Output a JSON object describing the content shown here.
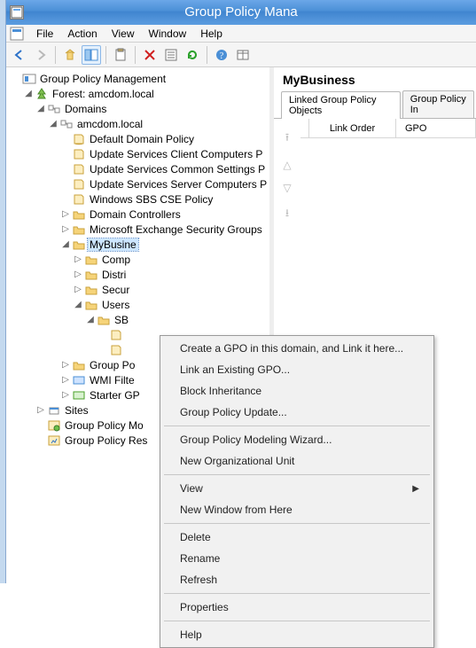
{
  "window": {
    "title": "Group Policy Mana"
  },
  "menus": {
    "file": "File",
    "action": "Action",
    "view": "View",
    "window": "Window",
    "help": "Help"
  },
  "toolbar_icons": [
    "back",
    "forward",
    "up",
    "show-hide",
    "clipboard",
    "delete",
    "refresh",
    "run",
    "help",
    "columns"
  ],
  "tree": {
    "root": "Group Policy Management",
    "forest": "Forest: amcdom.local",
    "domains": "Domains",
    "domain": "amcdom.local",
    "gpo_default": "Default Domain Policy",
    "gpo_update_client": "Update Services Client Computers P",
    "gpo_update_common": "Update Services Common Settings P",
    "gpo_update_server": "Update Services Server Computers P",
    "gpo_sbs": "Windows SBS CSE Policy",
    "ou_dc": "Domain Controllers",
    "ou_mesg": "Microsoft Exchange Security Groups",
    "ou_mb": "MyBusine",
    "ou_comp": "Comp",
    "ou_dist": "Distri",
    "ou_sec": "Secur",
    "ou_users": "Users",
    "ou_sb": "SB",
    "gp_folder": "Group Po",
    "wmi": "WMI Filte",
    "starter": "Starter GP",
    "sites": "Sites",
    "gpmod": "Group Policy Mo",
    "gpres": "Group Policy Res"
  },
  "detail": {
    "title": "MyBusiness",
    "tab_linked": "Linked Group Policy Objects",
    "tab_inh": "Group Policy In",
    "col_link": "Link Order",
    "col_gpo": "GPO"
  },
  "ctx": {
    "create": "Create a GPO in this domain, and Link it here...",
    "link": "Link an Existing GPO...",
    "block": "Block Inheritance",
    "update": "Group Policy Update...",
    "wizard": "Group Policy Modeling Wizard...",
    "newou": "New Organizational Unit",
    "view": "View",
    "newwin": "New Window from Here",
    "delete": "Delete",
    "rename": "Rename",
    "refresh": "Refresh",
    "props": "Properties",
    "help": "Help"
  }
}
